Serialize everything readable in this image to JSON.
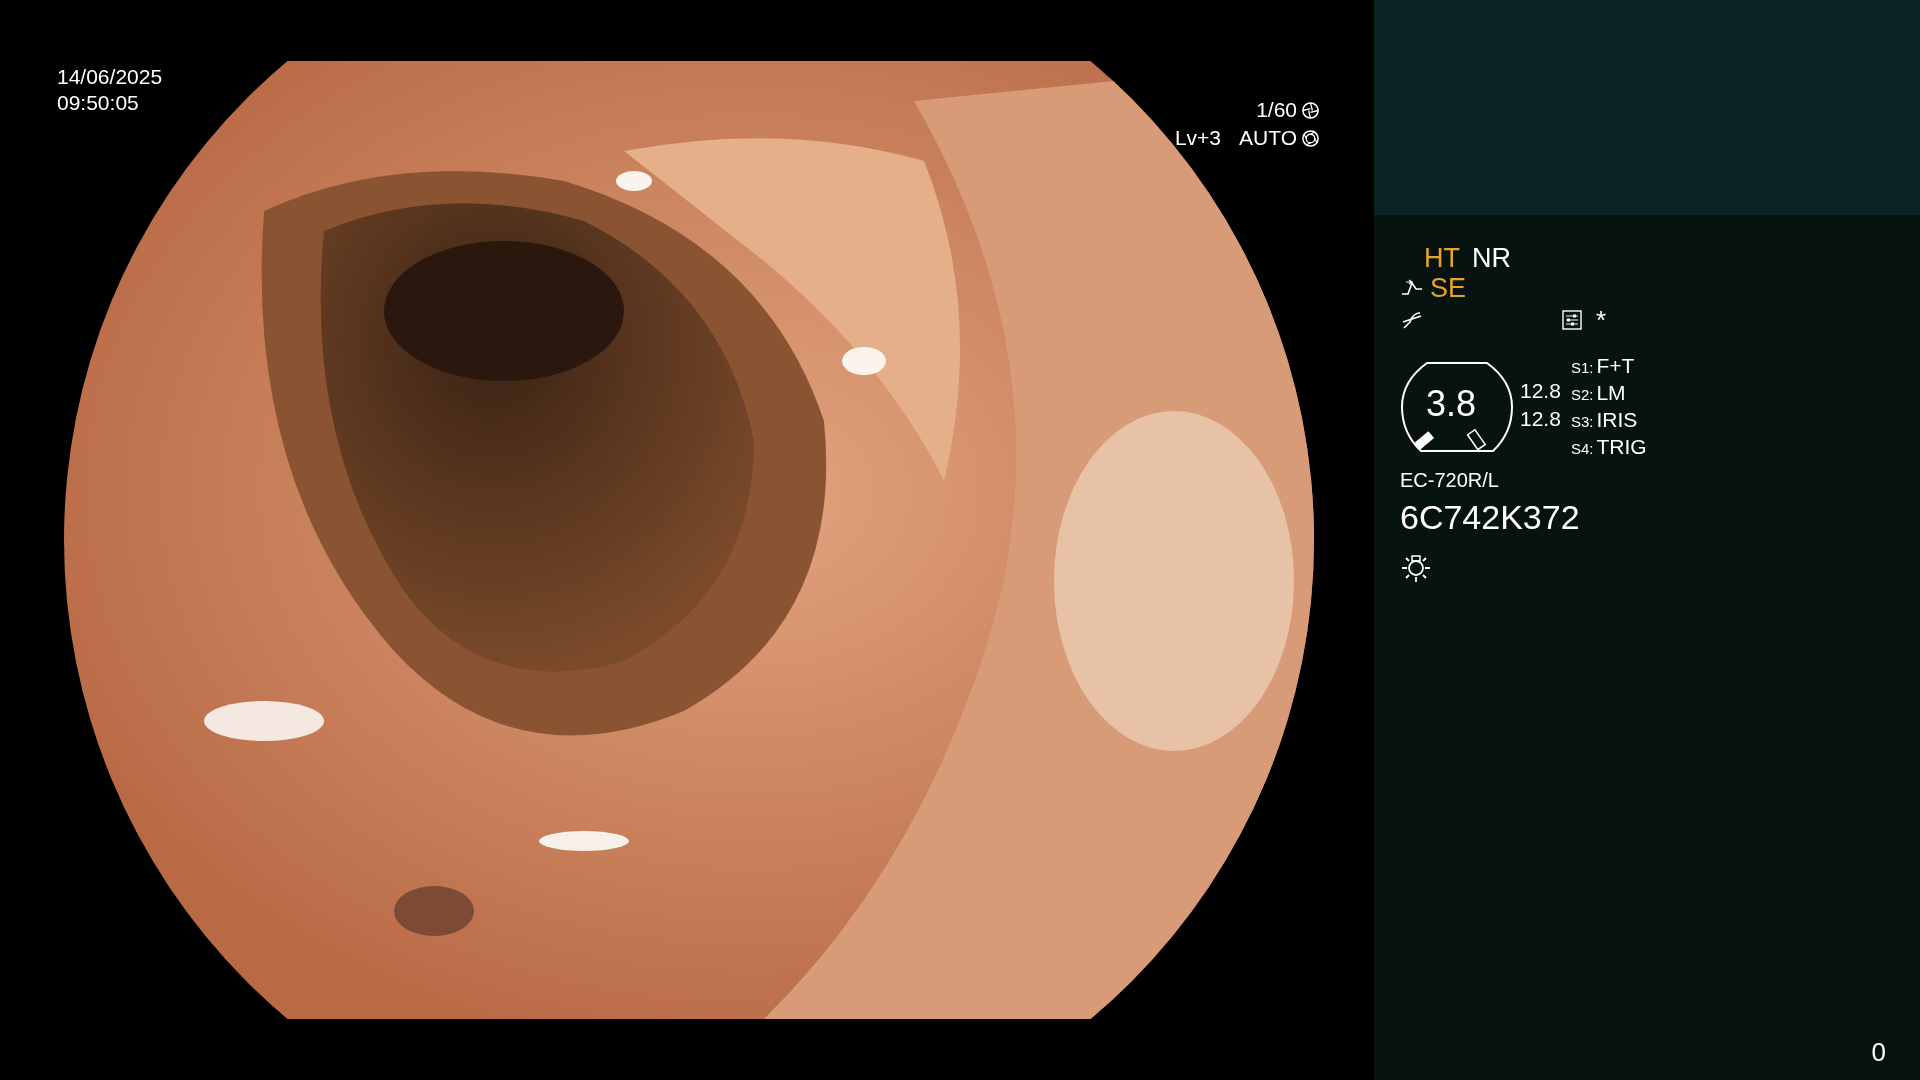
{
  "overlay": {
    "date": "14/06/2025",
    "time": "09:50:05",
    "shutter": "1/60",
    "level": "Lv+3",
    "iris_mode": "AUTO"
  },
  "sidebar": {
    "mode_tags_row1": [
      {
        "text": "HT",
        "color": "#e9a423"
      },
      {
        "text": "NR",
        "color": "#ffffff"
      }
    ],
    "mode_tags_row2": [
      {
        "text": "SE",
        "color": "#e9a423"
      }
    ],
    "asterisk": "*",
    "gauge": {
      "value": "3.8"
    },
    "readings": [
      "12.8",
      "12.8"
    ],
    "switches": [
      {
        "key": "S1:",
        "value": "F+T"
      },
      {
        "key": "S2:",
        "value": "LM"
      },
      {
        "key": "S3:",
        "value": "IRIS"
      },
      {
        "key": "S4:",
        "value": "TRIG"
      }
    ],
    "scope_model": "EC-720R/L",
    "scope_serial": "6C742K372"
  },
  "counter": "0"
}
